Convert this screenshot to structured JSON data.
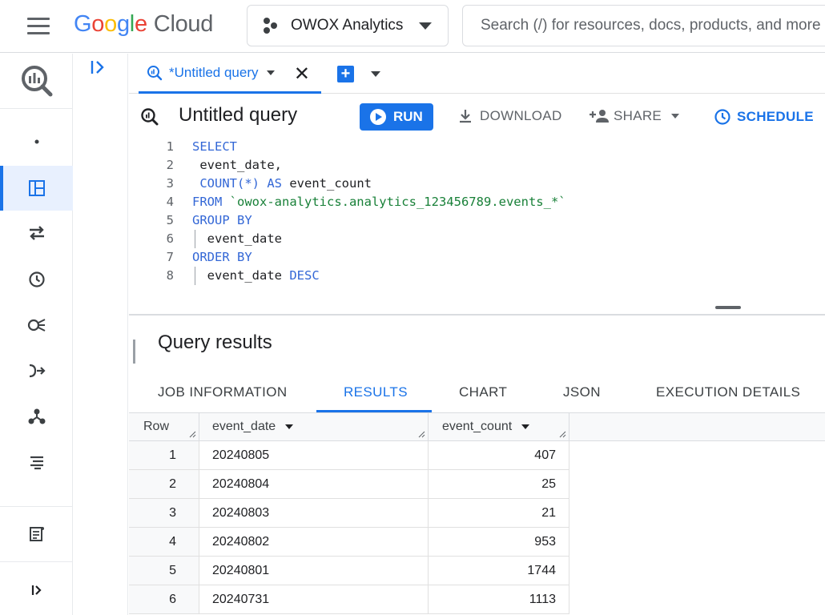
{
  "header": {
    "logo_google": [
      "G",
      "o",
      "o",
      "g",
      "l",
      "e"
    ],
    "logo_cloud": "Cloud",
    "project": "OWOX Analytics",
    "search_placeholder": "Search (/) for resources, docs, products, and more"
  },
  "rail": {
    "items": [
      {
        "icon": "bigquery-logo-icon"
      },
      {
        "icon": "dot-icon"
      },
      {
        "icon": "studio-icon",
        "active": true
      },
      {
        "icon": "data-transfers-icon"
      },
      {
        "icon": "scheduled-queries-icon"
      },
      {
        "icon": "analytics-hub-icon"
      },
      {
        "icon": "dataform-icon"
      },
      {
        "icon": "partner-center-icon"
      },
      {
        "icon": "settings-list-icon"
      },
      {
        "icon": "release-notes-icon"
      },
      {
        "icon": "expand-icon"
      }
    ]
  },
  "tabs": {
    "active_label": "*Untitled query"
  },
  "toolbar": {
    "title": "Untitled query",
    "run": "RUN",
    "download": "DOWNLOAD",
    "share": "SHARE",
    "schedule": "SCHEDULE"
  },
  "editor": {
    "line_numbers": [
      "1",
      "2",
      "3",
      "4",
      "5",
      "6",
      "7",
      "8"
    ],
    "lines": [
      [
        {
          "t": "SELECT",
          "c": "kw"
        }
      ],
      [
        {
          "t": " event_date,",
          "c": ""
        }
      ],
      [
        {
          "t": " COUNT(*) ",
          "c": "kw"
        },
        {
          "t": "AS",
          "c": "kw"
        },
        {
          "t": " event_count",
          "c": ""
        }
      ],
      [
        {
          "t": "FROM ",
          "c": "kw"
        },
        {
          "t": "`owox-analytics.analytics_123456789.events_*`",
          "c": "str"
        }
      ],
      [
        {
          "t": "GROUP BY",
          "c": "kw"
        }
      ],
      [
        {
          "t": "  event_date",
          "c": ""
        }
      ],
      [
        {
          "t": "ORDER BY",
          "c": "kw"
        }
      ],
      [
        {
          "t": "  event_date ",
          "c": ""
        },
        {
          "t": "DESC",
          "c": "kw"
        }
      ]
    ]
  },
  "results": {
    "title": "Query results",
    "tabs": [
      "JOB INFORMATION",
      "RESULTS",
      "CHART",
      "JSON",
      "EXECUTION DETAILS"
    ],
    "active_tab": "RESULTS",
    "columns": [
      "Row",
      "event_date",
      "event_count"
    ],
    "rows": [
      [
        "1",
        "20240805",
        "407"
      ],
      [
        "2",
        "20240804",
        "25"
      ],
      [
        "3",
        "20240803",
        "21"
      ],
      [
        "4",
        "20240802",
        "953"
      ],
      [
        "5",
        "20240801",
        "1744"
      ],
      [
        "6",
        "20240731",
        "1113"
      ]
    ]
  },
  "colors": {
    "accent": "#1a73e8",
    "keyword": "#3367d6",
    "string": "#188038",
    "text": "#202124",
    "muted": "#5f6368"
  }
}
